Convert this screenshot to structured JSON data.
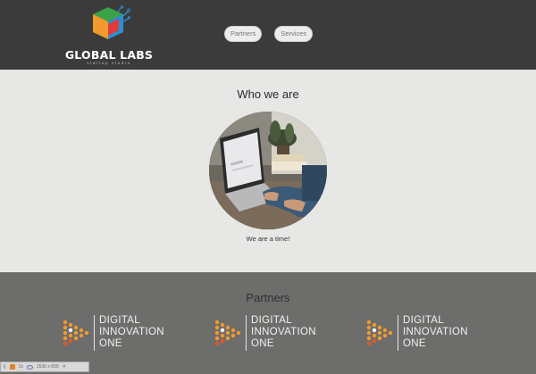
{
  "header": {
    "brand_name": "GLOBAL LABS",
    "brand_tagline": "startup studio",
    "nav": [
      {
        "label": "Partners"
      },
      {
        "label": "Services"
      }
    ]
  },
  "about": {
    "title": "Who we are",
    "caption": "We are a time!"
  },
  "partners": {
    "title": "Partners",
    "items": [
      {
        "line1": "DIGITAL",
        "line2": "INNOVATION",
        "line3": "ONE"
      },
      {
        "line1": "DIGITAL",
        "line2": "INNOVATION",
        "line3": "ONE"
      },
      {
        "line1": "DIGITAL",
        "line2": "INNOVATION",
        "line3": "ONE"
      }
    ]
  },
  "devbar": {
    "zoom": "1x",
    "resolution": "1536 x 839"
  },
  "colors": {
    "header_bg": "#3b3b3b",
    "about_bg": "#e7e7e5",
    "partners_bg": "#6d6d6b",
    "accent_orange": "#f29a2e"
  },
  "icons": [
    "global-labs-cube-logo",
    "laptop-photo",
    "digital-innovation-one-logo",
    "eye-icon"
  ]
}
